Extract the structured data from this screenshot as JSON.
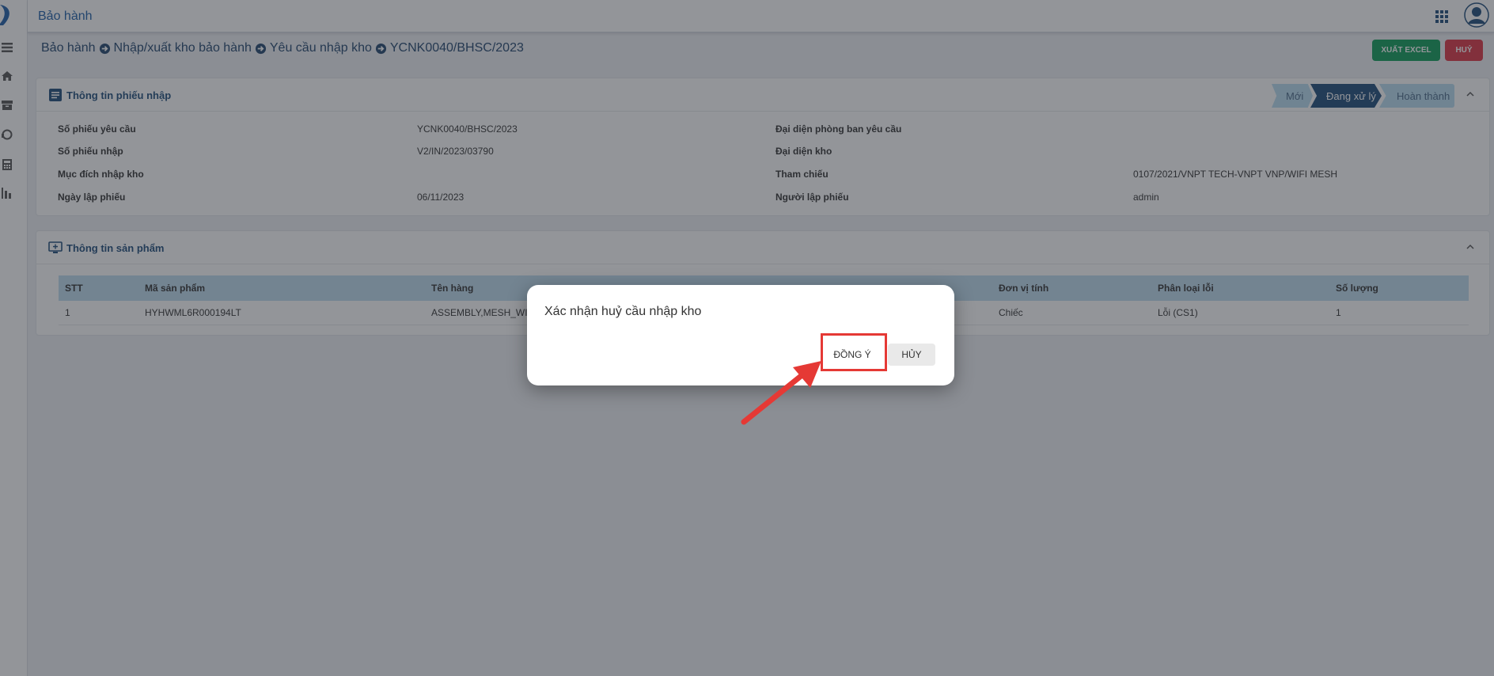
{
  "app": {
    "title": "Bảo hành"
  },
  "breadcrumb": {
    "item1": "Bảo hành",
    "item2": "Nhập/xuất kho bảo hành",
    "item3": "Yêu cầu nhập kho",
    "item4": "YCNK0040/BHSC/2023"
  },
  "actions": {
    "export_label": "XUẤT EXCEL",
    "cancel_label": "HUỶ"
  },
  "receipt_card": {
    "title": "Thông tin phiếu nhập",
    "steps": {
      "new": "Mới",
      "processing": "Đang xử lý",
      "done": "Hoàn thành"
    },
    "fields": {
      "request_no_label": "Số phiếu yêu cầu",
      "request_no_value": "YCNK0040/BHSC/2023",
      "import_no_label": "Số phiếu nhập",
      "import_no_value": "V2/IN/2023/03790",
      "purpose_label": "Mục đích nhập kho",
      "purpose_value": "",
      "date_label": "Ngày lập phiếu",
      "date_value": "06/11/2023",
      "dept_rep_label": "Đại diện phòng ban yêu cầu",
      "dept_rep_value": "",
      "warehouse_rep_label": "Đại diện kho",
      "warehouse_rep_value": "",
      "reference_label": "Tham chiếu",
      "reference_value": "0107/2021/VNPT TECH-VNPT VNP/WIFI MESH",
      "creator_label": "Người lập phiếu",
      "creator_value": "admin"
    }
  },
  "product_card": {
    "title": "Thông tin sản phẩm",
    "columns": {
      "stt": "STT",
      "code": "Mã sản phẩm",
      "name": "Tên hàng",
      "unit": "Đơn vị tính",
      "error_type": "Phân loại lỗi",
      "qty": "Số lượng"
    },
    "rows": [
      {
        "stt": "1",
        "code": "HYHWML6R000194LT",
        "name": "ASSEMBLY,MESH_WIF",
        "unit": "Chiếc",
        "error_type": "Lỗi (CS1)",
        "qty": "1"
      }
    ]
  },
  "dialog": {
    "message": "Xác nhận huỷ cầu nhập kho",
    "ok_label": "ĐỒNG Ý",
    "cancel_label": "HỦY"
  },
  "colors": {
    "brand": "#1f4c7a",
    "export": "#0f9d58",
    "cancel": "#dc3545",
    "annotation": "#e53935"
  }
}
